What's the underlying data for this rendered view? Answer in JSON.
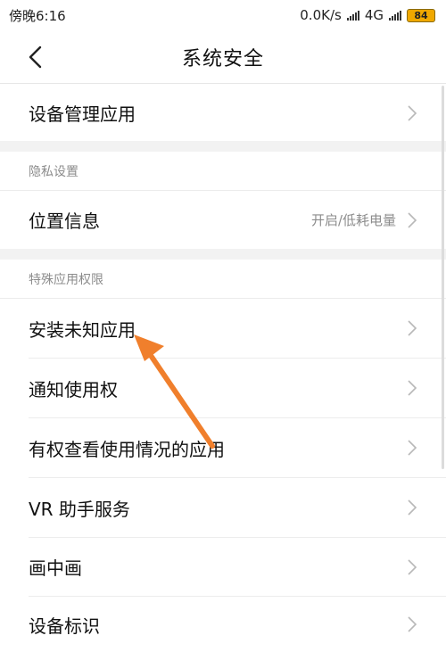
{
  "status_bar": {
    "time": "傍晚6:16",
    "network_speed": "0.0K/s",
    "network_type": "4G",
    "battery": "84"
  },
  "header": {
    "title": "系统安全"
  },
  "rows": {
    "device_admin": "设备管理应用",
    "location": "位置信息",
    "location_value": "开启/低耗电量",
    "install_unknown": "安装未知应用",
    "notification_access": "通知使用权",
    "usage_access": "有权查看使用情况的应用",
    "vr_helper": "VR 助手服务",
    "pip": "画中画",
    "device_id": "设备标识"
  },
  "sections": {
    "privacy": "隐私设置",
    "special_access": "特殊应用权限"
  },
  "annotation": {
    "arrow_color": "#f07f2c"
  }
}
